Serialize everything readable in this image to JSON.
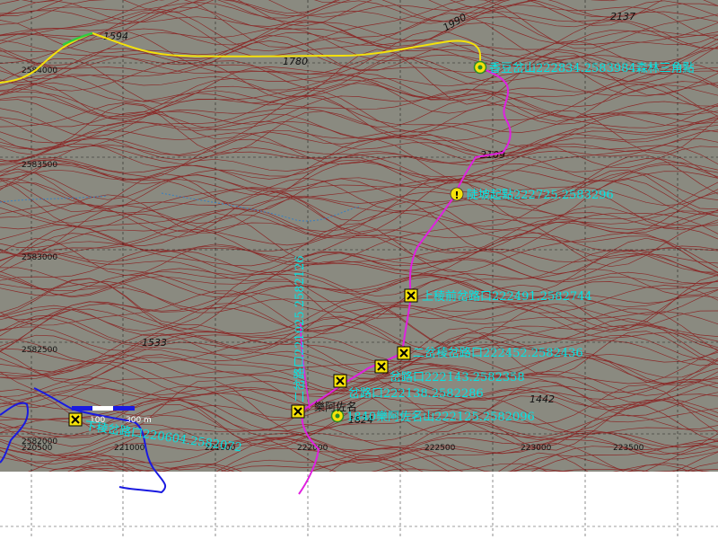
{
  "map": {
    "colors": {
      "terrain": "#8a8a80",
      "contour": "#8b1a1a",
      "track_yellow": "#f5e10a",
      "track_magenta": "#e020e0",
      "track_green": "#2ecc40",
      "river": "#1a1ae0",
      "stream": "#3a7fbf",
      "label": "#00e5e5",
      "grid": "#000000"
    },
    "grid_labels": {
      "northing": [
        "2584000",
        "2583500",
        "2583000",
        "2582500",
        "2582000"
      ],
      "easting": [
        "220500",
        "221000",
        "221500",
        "222000",
        "222500",
        "223000",
        "223500"
      ]
    },
    "elevations": [
      "1594",
      "1780",
      "1990",
      "2137",
      "1533",
      "1442",
      "1824",
      "2109"
    ],
    "waypoints": [
      {
        "label": "香豆岔山222834.2583984森林三角點",
        "type": "summit-icon"
      },
      {
        "label": "陡坡起點222725.2583296",
        "type": "warning-icon"
      },
      {
        "label": "上稜前岔路口222491.2582744",
        "type": "junction-icon"
      },
      {
        "label": "二岔稜岔路口222452.2582436",
        "type": "junction-icon"
      },
      {
        "label": "岔路口222143.2582358",
        "type": "junction-icon"
      },
      {
        "label": "岔路口222138.2582286",
        "type": "junction-icon"
      },
      {
        "label": "1840樂阿佐名山222125.2582096",
        "type": "summit-icon"
      },
      {
        "label": "二岔路口221025.2582126",
        "type": "junction-icon"
      },
      {
        "label": "樂阿佐名",
        "type": "peak-label"
      },
      {
        "label": "下稜岔路口220604.2582072",
        "type": "junction-icon"
      }
    ],
    "scale_bar": {
      "label_left": "0",
      "label_mid": "100",
      "label_right": "300 m"
    }
  }
}
